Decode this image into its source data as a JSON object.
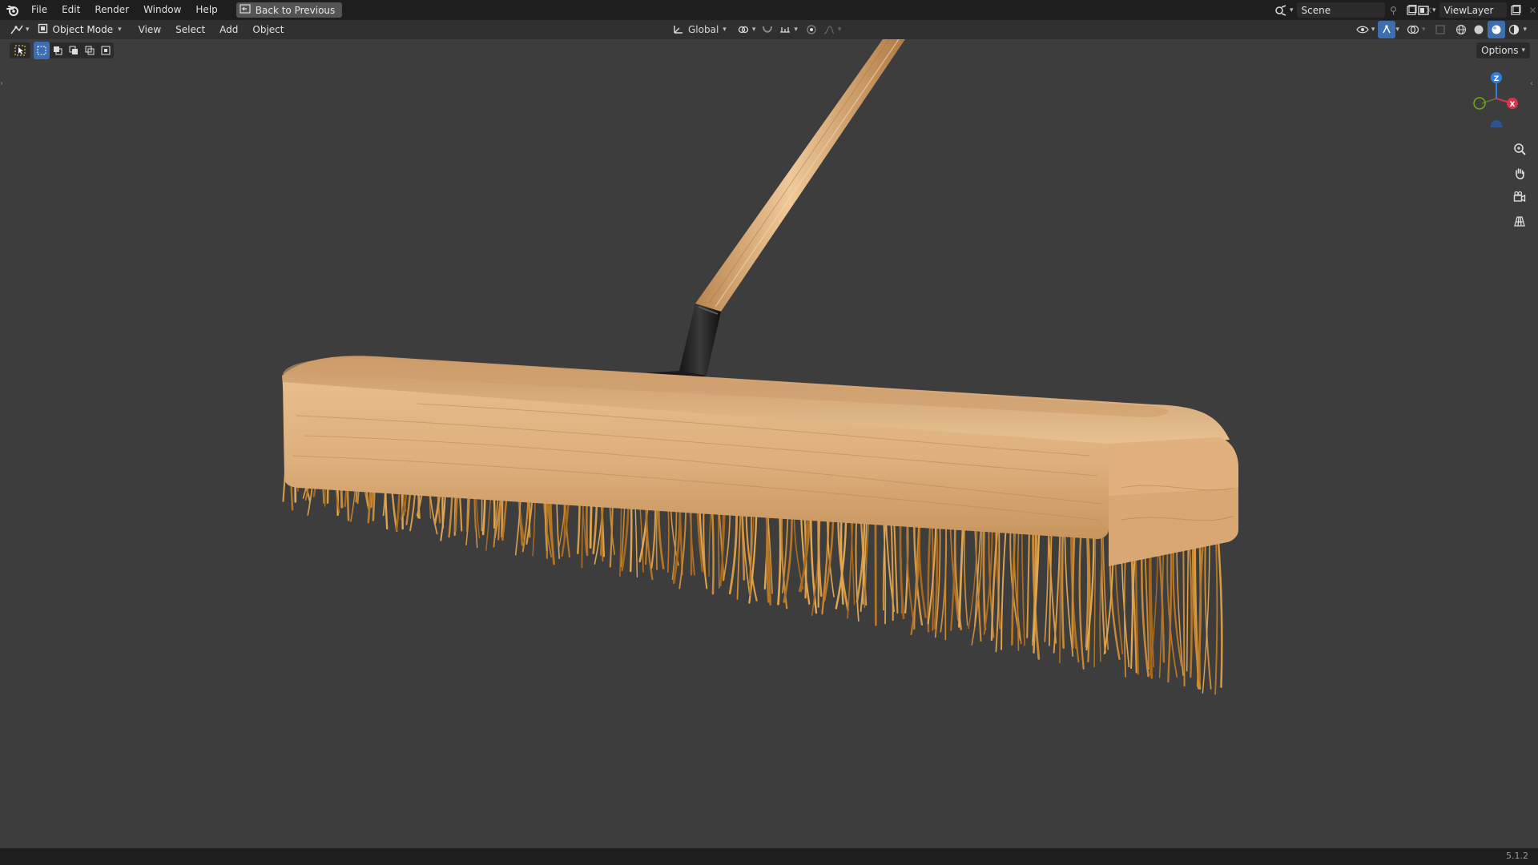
{
  "topbar": {
    "menu": [
      "File",
      "Edit",
      "Render",
      "Window",
      "Help"
    ],
    "back_label": "Back to Previous",
    "scene_name": "Scene",
    "view_layer_name": "ViewLayer"
  },
  "header": {
    "mode": "Object Mode",
    "menus": [
      "View",
      "Select",
      "Add",
      "Object"
    ],
    "transform_orientation": "Global",
    "options_label": "Options"
  },
  "status": {
    "version": "5.1.2"
  },
  "colors": {
    "viewport_bg": "#3d3d3d",
    "axis_x": "#e0304a",
    "axis_y": "#6fa81c",
    "axis_z": "#2f7fe0",
    "wood": "#d9a872",
    "bristles": "#c98a35"
  },
  "icons": [
    "blender-logo-icon",
    "back-icon",
    "scene-icon",
    "view-layer-icon",
    "zoom-icon",
    "hand-pan-icon",
    "camera-icon",
    "grid-icon"
  ]
}
